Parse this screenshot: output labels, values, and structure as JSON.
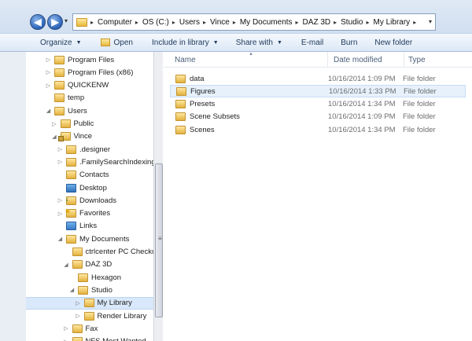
{
  "address_bar": {
    "crumbs": [
      "Computer",
      "OS (C:)",
      "Users",
      "Vince",
      "My Documents",
      "DAZ 3D",
      "Studio",
      "My Library"
    ]
  },
  "toolbar": {
    "organize": "Organize",
    "open": "Open",
    "include_in_library": "Include in library",
    "share_with": "Share with",
    "email": "E-mail",
    "burn": "Burn",
    "new_folder": "New folder"
  },
  "nav_tree": [
    {
      "label": "Program Files",
      "indent": 0,
      "expander": "collapsed",
      "icon": "folder-icon"
    },
    {
      "label": "Program Files (x86)",
      "indent": 0,
      "expander": "collapsed",
      "icon": "folder-icon"
    },
    {
      "label": "QUICKENW",
      "indent": 0,
      "expander": "collapsed",
      "icon": "folder-icon"
    },
    {
      "label": "temp",
      "indent": 0,
      "expander": "none",
      "icon": "folder-icon"
    },
    {
      "label": "Users",
      "indent": 0,
      "expander": "expanded",
      "icon": "folder-icon"
    },
    {
      "label": "Public",
      "indent": 1,
      "expander": "collapsed",
      "icon": "folder-icon"
    },
    {
      "label": "Vince",
      "indent": 1,
      "expander": "expanded",
      "icon": "locked-folder-icon"
    },
    {
      "label": ".designer",
      "indent": 2,
      "expander": "collapsed",
      "icon": "folder-icon"
    },
    {
      "label": ".FamilySearchIndexing",
      "indent": 2,
      "expander": "collapsed",
      "icon": "folder-icon"
    },
    {
      "label": "Contacts",
      "indent": 2,
      "expander": "none",
      "icon": "contacts-icon"
    },
    {
      "label": "Desktop",
      "indent": 2,
      "expander": "none",
      "icon": "desktop-icon"
    },
    {
      "label": "Downloads",
      "indent": 2,
      "expander": "collapsed",
      "icon": "downloads-icon"
    },
    {
      "label": "Favorites",
      "indent": 2,
      "expander": "collapsed",
      "icon": "favorites-icon"
    },
    {
      "label": "Links",
      "indent": 2,
      "expander": "none",
      "icon": "links-icon"
    },
    {
      "label": "My Documents",
      "indent": 2,
      "expander": "expanded",
      "icon": "folder-icon"
    },
    {
      "label": "ctrlcenter PC Checku",
      "indent": 3,
      "expander": "none",
      "icon": "folder-icon"
    },
    {
      "label": "DAZ 3D",
      "indent": 3,
      "expander": "expanded",
      "icon": "folder-icon"
    },
    {
      "label": "Hexagon",
      "indent": 4,
      "expander": "none",
      "icon": "folder-icon"
    },
    {
      "label": "Studio",
      "indent": 4,
      "expander": "expanded",
      "icon": "folder-icon"
    },
    {
      "label": "My Library",
      "indent": 5,
      "expander": "collapsed",
      "icon": "folder-icon",
      "selected": true
    },
    {
      "label": "Render Library",
      "indent": 5,
      "expander": "collapsed",
      "icon": "folder-icon"
    },
    {
      "label": "Fax",
      "indent": 3,
      "expander": "collapsed",
      "icon": "folder-icon"
    },
    {
      "label": "NFS Most Wanted",
      "indent": 3,
      "expander": "collapsed",
      "icon": "folder-icon"
    }
  ],
  "columns": {
    "name": "Name",
    "date_modified": "Date modified",
    "type": "Type"
  },
  "files": [
    {
      "name": "data",
      "date": "10/16/2014 1:09 PM",
      "type": "File folder"
    },
    {
      "name": "Figures",
      "date": "10/16/2014 1:33 PM",
      "type": "File folder",
      "hover": true
    },
    {
      "name": "Presets",
      "date": "10/16/2014 1:34 PM",
      "type": "File folder"
    },
    {
      "name": "Scene Subsets",
      "date": "10/16/2014 1:09 PM",
      "type": "File folder"
    },
    {
      "name": "Scenes",
      "date": "10/16/2014 1:34 PM",
      "type": "File folder"
    }
  ]
}
